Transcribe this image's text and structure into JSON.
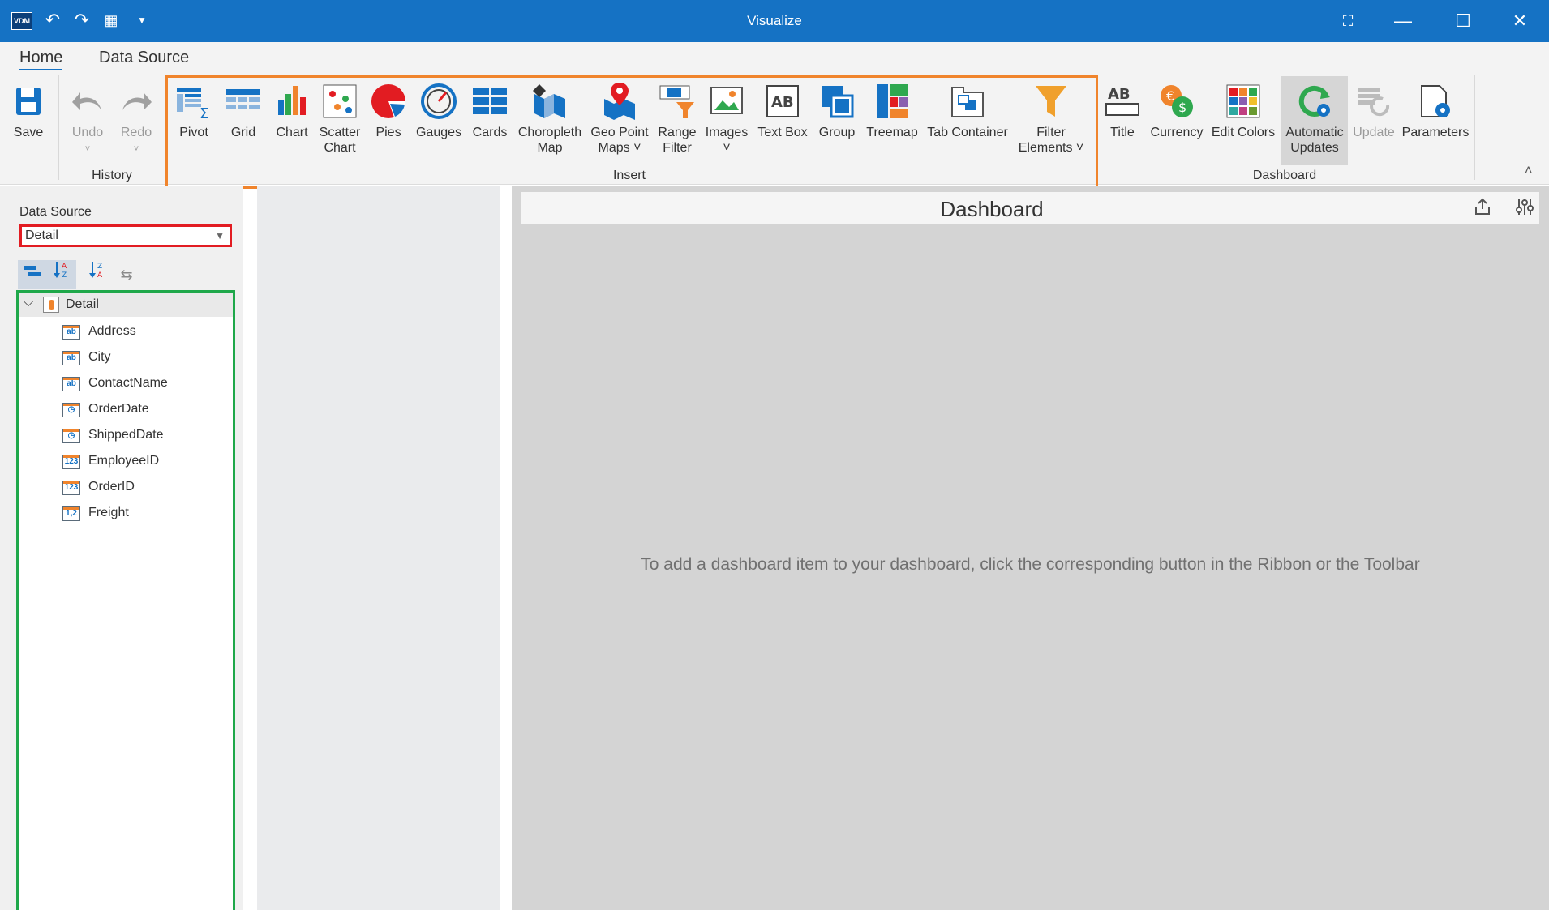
{
  "titlebar": {
    "title": "Visualize",
    "logo": "VDM",
    "quick_access": [
      "undo-icon",
      "redo-icon",
      "refresh-grid-icon",
      "dropdown-icon"
    ],
    "window_buttons": [
      "fullscreen-icon",
      "minimize-icon",
      "maximize-icon",
      "close-icon"
    ]
  },
  "ribbon": {
    "tabs": [
      {
        "label": "Home",
        "active": true
      },
      {
        "label": "Data Source",
        "active": false
      }
    ],
    "file": {
      "save": "Save"
    },
    "history": {
      "label": "History",
      "undo": "Undo",
      "redo": "Redo"
    },
    "insert": {
      "label": "Insert",
      "items": [
        {
          "l1": "Pivot",
          "l2": ""
        },
        {
          "l1": "Grid",
          "l2": ""
        },
        {
          "l1": "Chart",
          "l2": ""
        },
        {
          "l1": "Scatter",
          "l2": "Chart"
        },
        {
          "l1": "Pies",
          "l2": ""
        },
        {
          "l1": "Gauges",
          "l2": ""
        },
        {
          "l1": "Cards",
          "l2": ""
        },
        {
          "l1": "Choropleth",
          "l2": "Map"
        },
        {
          "l1": "Geo Point",
          "l2": "Maps ˅"
        },
        {
          "l1": "Range",
          "l2": "Filter"
        },
        {
          "l1": "Images",
          "l2": "˅"
        },
        {
          "l1": "Text Box",
          "l2": ""
        },
        {
          "l1": "Group",
          "l2": ""
        },
        {
          "l1": "Treemap",
          "l2": ""
        },
        {
          "l1": "Tab Container",
          "l2": ""
        },
        {
          "l1": "Filter",
          "l2": "Elements ˅"
        }
      ]
    },
    "dashboard": {
      "label": "Dashboard",
      "items": [
        {
          "l1": "Title",
          "l2": ""
        },
        {
          "l1": "Currency",
          "l2": ""
        },
        {
          "l1": "Edit Colors",
          "l2": ""
        },
        {
          "l1": "Automatic",
          "l2": "Updates"
        },
        {
          "l1": "Update",
          "l2": ""
        },
        {
          "l1": "Parameters",
          "l2": ""
        }
      ]
    },
    "colors": {
      "accent": "#1572c4",
      "insert_highlight": "#f0842c"
    }
  },
  "leftpanel": {
    "data_source_label": "Data Source",
    "data_source_value": "Detail",
    "root": "Detail",
    "fields": [
      {
        "name": "Address",
        "type": "ab"
      },
      {
        "name": "City",
        "type": "ab"
      },
      {
        "name": "ContactName",
        "type": "ab"
      },
      {
        "name": "OrderDate",
        "type": "◷"
      },
      {
        "name": "ShippedDate",
        "type": "◷"
      },
      {
        "name": "EmployeeID",
        "type": "123"
      },
      {
        "name": "OrderID",
        "type": "123"
      },
      {
        "name": "Freight",
        "type": "1,2"
      }
    ],
    "colors": {
      "datasource_highlight": "#e21c22",
      "fields_highlight": "#1fa84a"
    }
  },
  "dashboard": {
    "title": "Dashboard",
    "empty_message": "To add a dashboard item to your dashboard, click the corresponding button in the Ribbon or the Toolbar"
  }
}
